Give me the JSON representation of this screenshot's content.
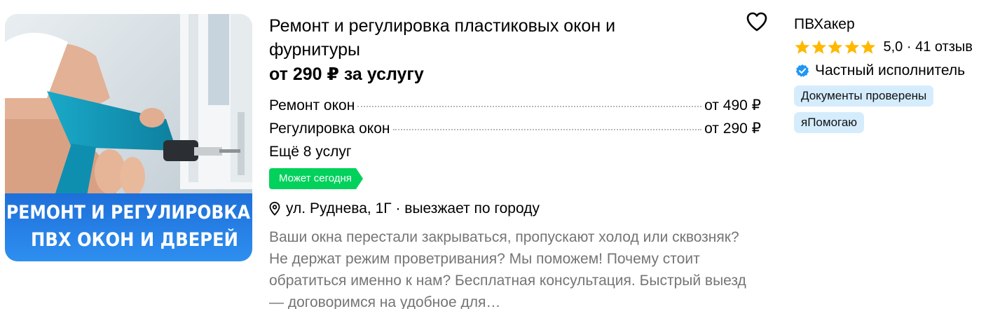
{
  "listing": {
    "title": "Ремонт и регулировка пластиковых окон и фурнитуры",
    "price": "от 290 ₽ за услугу",
    "services": [
      {
        "name": "Ремонт окон",
        "price": "от 490 ₽"
      },
      {
        "name": "Регулировка окон",
        "price": "от 290 ₽"
      }
    ],
    "more_services": "Ещё 8 услуг",
    "today_badge": "Может сегодня",
    "address": "ул. Руднева, 1Г · выезжает по городу",
    "description": "Ваши окна перестали закрываться, пропускают холод или сквозняк? Не держат режим проветривания? Мы поможем! Почему стоит обратиться именно к нам? Бесплатная консультация. Быстрый выезд — договоримся на удобное для…",
    "photo": {
      "banner_line1": "РЕМОНТ И РЕГУЛИРОВКА",
      "banner_line2": "ПВХ ОКОН И ДВЕРЕЙ"
    },
    "favorite_icon": "heart-outline-icon"
  },
  "seller": {
    "name": "ПВХакер",
    "rating": "5,0",
    "reviews": "41 отзыв",
    "rating_text": "5,0 · 41 отзыв",
    "stars": 5,
    "type": "Частный исполнитель",
    "badges": [
      "Документы проверены",
      "яПомогаю"
    ]
  },
  "colors": {
    "star": "#ffb800",
    "today_badge": "#02d15c",
    "verified": "#2196f3",
    "chip_bg": "#d5ecfc",
    "description": "#757575"
  }
}
